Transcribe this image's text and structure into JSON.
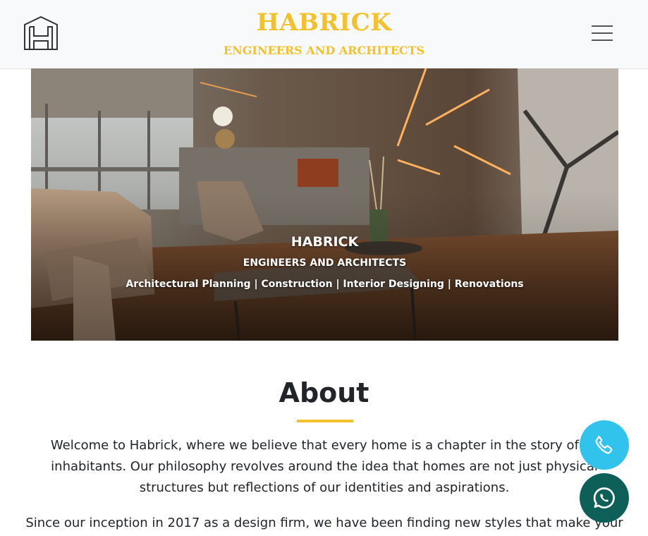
{
  "header": {
    "brand_title": "HABRICK",
    "brand_subtitle": "ENGINEERS AND ARCHITECTS",
    "logo_icon": "h-monogram-logo",
    "menu_icon": "hamburger-menu-icon"
  },
  "hero": {
    "title": "HABRICK",
    "subtitle": "ENGINEERS AND ARCHITECTS",
    "services": "Architectural Planning | Construction | Interior Designing | Renovations"
  },
  "about": {
    "heading": "About",
    "paragraph1": "Welcome to Habrick, where we believe that every home is a chapter in the story of its inhabitants. Our philosophy revolves around the idea that homes are not just physical structures but reflections of our identities and aspirations.",
    "paragraph2": "Since our inception in 2017 as a design firm, we have been finding new styles that make your"
  },
  "floating": {
    "phone_icon": "phone-icon",
    "whatsapp_icon": "whatsapp-icon"
  },
  "colors": {
    "brand": "#f3c12b",
    "phone": "#31c3ec",
    "whatsapp": "#0e5f57"
  }
}
